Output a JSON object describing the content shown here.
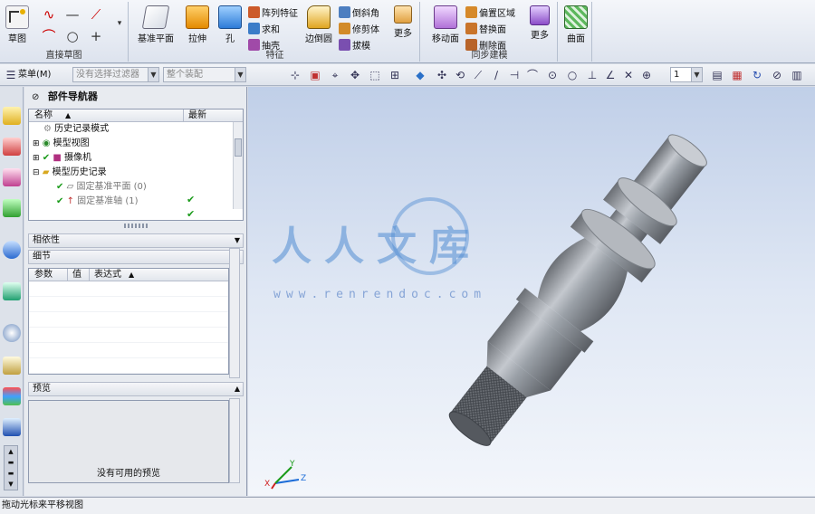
{
  "ribbon": {
    "sketch_label": "草图",
    "direct_sketch_group": "直接草图",
    "datum_plane_label": "基准平面",
    "extrude_label": "拉伸",
    "hole_label": "孔",
    "array_feature_label": "阵列特征",
    "unite_label": "求和",
    "shell_label": "抽壳",
    "feature_group": "特征",
    "edge_blend_label": "边倒圆",
    "chamfer_label": "倒斜角",
    "trim_body_label": "修剪体",
    "draft_label": "拔模",
    "more_label_1": "更多",
    "move_face_label": "移动面",
    "offset_region_label": "偏置区域",
    "replace_face_label": "替换面",
    "delete_face_label": "删除面",
    "more_label_2": "更多",
    "sync_modeling_group": "同步建模",
    "surface_label": "曲面"
  },
  "toolbar": {
    "menu_label": "菜单(M)",
    "filter_placeholder": "没有选择过滤器",
    "assembly_placeholder": "整个装配",
    "layer_value": "1"
  },
  "navigator": {
    "title": "部件导航器",
    "col_name": "名称",
    "col_latest": "最新",
    "tree": [
      {
        "label": "历史记录模式"
      },
      {
        "label": "模型视图"
      },
      {
        "label": "摄像机"
      },
      {
        "label": "模型历史记录"
      },
      {
        "label": "固定基准平面 (0)"
      },
      {
        "label": "固定基准轴 (1)"
      }
    ],
    "dependency_label": "相依性",
    "details_label": "细节",
    "detail_cols": {
      "param": "参数",
      "value": "值",
      "expression": "表达式"
    },
    "preview_label": "预览",
    "no_preview_text": "没有可用的预览"
  },
  "viewport": {
    "watermark_text": "人人文库",
    "watermark_url": "www.renrendoc.com",
    "triad_x": "X",
    "triad_y": "Y",
    "triad_z": "Z"
  },
  "status": {
    "message": "拖动光标来平移视图"
  },
  "colors": {
    "viewport_top": "#c0cfe8",
    "viewport_bottom": "#f3f6fb",
    "check_green": "#1b9b1b"
  }
}
